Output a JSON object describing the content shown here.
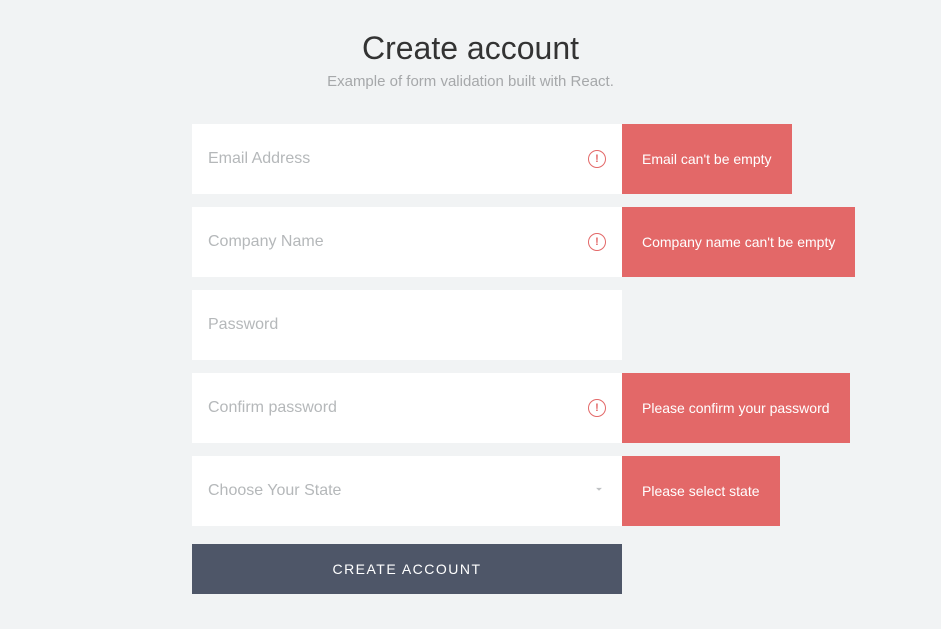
{
  "header": {
    "title": "Create account",
    "subtitle": "Example of form validation built with React."
  },
  "fields": {
    "email": {
      "placeholder": "Email Address",
      "value": "",
      "error": "Email can't be empty"
    },
    "company": {
      "placeholder": "Company Name",
      "value": "",
      "error": "Company name can't be empty"
    },
    "password": {
      "placeholder": "Password",
      "value": ""
    },
    "confirm": {
      "placeholder": "Confirm password",
      "value": "",
      "error": "Please confirm your password"
    },
    "state": {
      "placeholder": "Choose Your State",
      "error": "Please select state"
    }
  },
  "submit": {
    "label": "CREATE ACCOUNT"
  }
}
